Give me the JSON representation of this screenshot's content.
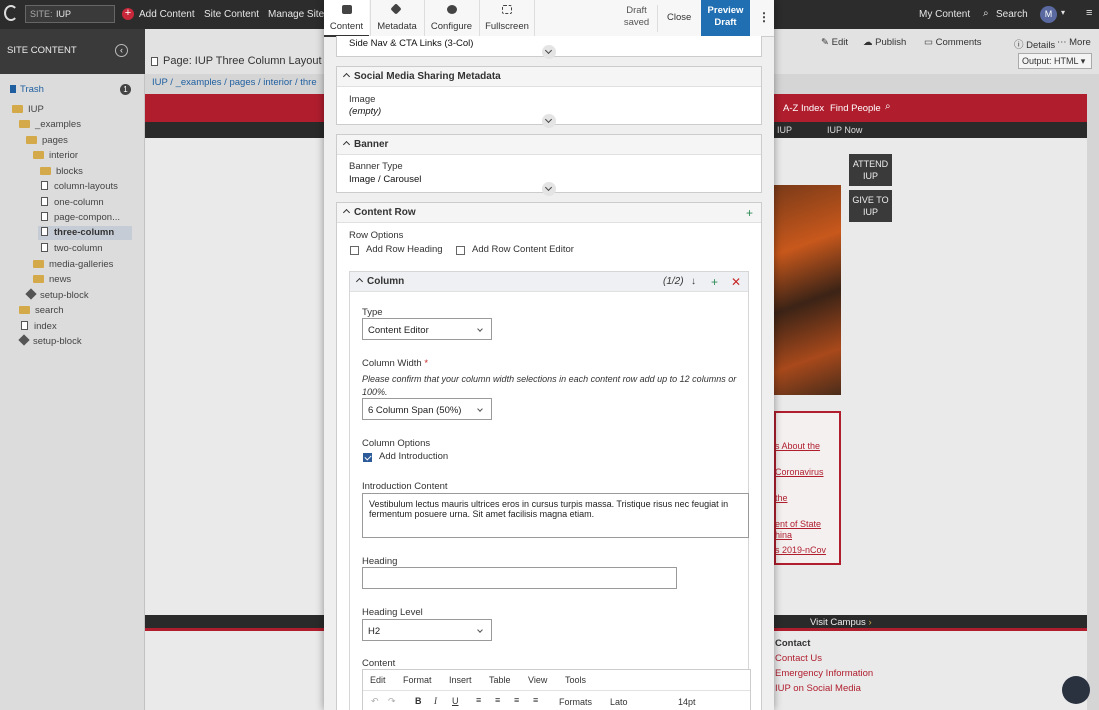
{
  "topbar": {
    "site_label": "SITE:",
    "site_value": "IUP",
    "add_content": "Add Content",
    "site_content": "Site Content",
    "manage_site": "Manage Site",
    "my_content": "My Content",
    "search": "Search",
    "avatar": "M"
  },
  "sidebar": {
    "title": "SITE CONTENT",
    "trash": "Trash",
    "trash_count": "1",
    "items": [
      "IUP",
      "_examples",
      "pages",
      "interior",
      "blocks",
      "column-layouts",
      "one-column",
      "page-compon...",
      "three-column",
      "two-column",
      "media-galleries",
      "news",
      "setup-block",
      "search",
      "index",
      "setup-block"
    ]
  },
  "main": {
    "page_title": "Page: IUP Three Column Layout",
    "breadcrumb": [
      "IUP",
      "_examples",
      "pages",
      "interior",
      "thre"
    ],
    "actions": [
      "Edit",
      "Publish",
      "Comments",
      "Details",
      "More"
    ],
    "output": "Output: HTML"
  },
  "preview": {
    "nav": [
      "A-Z Index",
      "Find People"
    ],
    "subnav": [
      "IUP",
      "IUP Now"
    ],
    "buttons": [
      "ATTEND IUP",
      "GIVE TO IUP"
    ],
    "links": [
      "s About the",
      "Coronavirus",
      "the",
      "ent of State",
      "hina",
      "s 2019-nCov"
    ],
    "footer_cta": "Visit Campus",
    "contact_title": "Contact",
    "contact_links": [
      "Contact Us",
      "Emergency Information",
      "IUP on Social Media"
    ]
  },
  "modal": {
    "tabs": [
      "Content",
      "Metadata",
      "Configure",
      "Fullscreen"
    ],
    "status": "Draft saved",
    "close": "Close",
    "preview_draft": "Preview Draft",
    "top_value": "Side Nav & CTA Links (3-Col)",
    "social_title": "Social Media Sharing Metadata",
    "image_label": "Image",
    "image_value": "(empty)",
    "banner_title": "Banner",
    "banner_type_label": "Banner Type",
    "banner_type_value": "Image / Carousel",
    "content_row_title": "Content Row",
    "row_options": "Row Options",
    "add_row_heading": "Add Row Heading",
    "add_row_content_editor": "Add Row Content Editor",
    "column_title": "Column",
    "column_count": "(1/2)",
    "type_label": "Type",
    "type_value": "Content Editor",
    "width_label": "Column Width",
    "width_help": "Please confirm that your column width selections in each content row add up to 12 columns or 100%.",
    "width_value": "6 Column Span (50%)",
    "col_options": "Column Options",
    "add_intro": "Add Introduction",
    "intro_label": "Introduction Content",
    "intro_text": "Vestibulum lectus mauris ultrices eros in cursus turpis massa. Tristique risus nec feugiat in fermentum posuere urna. Sit amet facilisis magna etiam.",
    "heading_label": "Heading",
    "heading_value": "",
    "heading_level_label": "Heading Level",
    "heading_level_value": "H2",
    "content_label": "Content",
    "editor_menu": [
      "Edit",
      "Format",
      "Insert",
      "Table",
      "View",
      "Tools"
    ],
    "editor_formats": "Formats",
    "editor_font": "Lato",
    "editor_size": "14pt"
  },
  "colors": {
    "accent": "#1f6fb2",
    "iup_red": "#b01e2e",
    "dark": "#2c2c2c"
  }
}
